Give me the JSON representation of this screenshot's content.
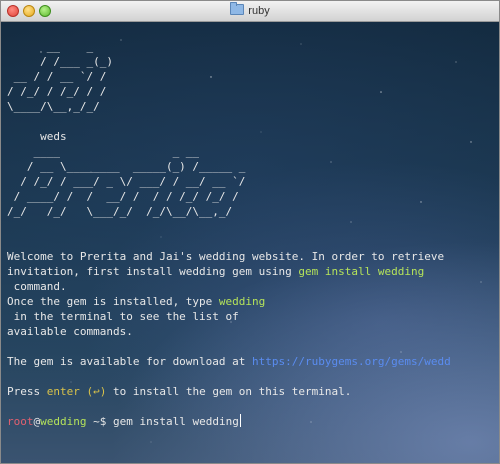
{
  "window": {
    "title": "ruby"
  },
  "art": {
    "logo_top": "      __    _\n     / /___ _(_)\n __ / / __ `/ /\n/ /_/ / /_/ / /\n\\____/\\__,_/_/",
    "weds": "     weds",
    "logo_bottom": "    ____                 _ __\n   / __ \\________  _____(_) /_____ _\n  / /_/ / ___/ _ \\/ ___/ / __/ __ `/\n / ____/ /  /  __/ /  / / /_/ /_/ /\n/_/   /_/   \\___/_/  /_/\\__/\\__,_/"
  },
  "intro": {
    "line1": "Welcome to Prerita and Jai's wedding website. In order to retrieve",
    "line2_pre": "invitation, first install wedding gem using ",
    "line2_cmd": "gem install wedding",
    "line3": " command.",
    "line4_pre": "Once the gem is installed, type ",
    "line4_cmd": "wedding",
    "line5": " in the terminal to see the list of",
    "line6": "available commands."
  },
  "download": {
    "pre": "The gem is available for download at ",
    "link": "https://rubygems.org/gems/wedd"
  },
  "press": {
    "pre": "Press ",
    "key": "enter (↩)",
    "post": " to install the gem on this terminal."
  },
  "prompt": {
    "user": "root",
    "at": "@",
    "host": "wedding",
    "path": " ~$ ",
    "command": "gem install wedding"
  }
}
